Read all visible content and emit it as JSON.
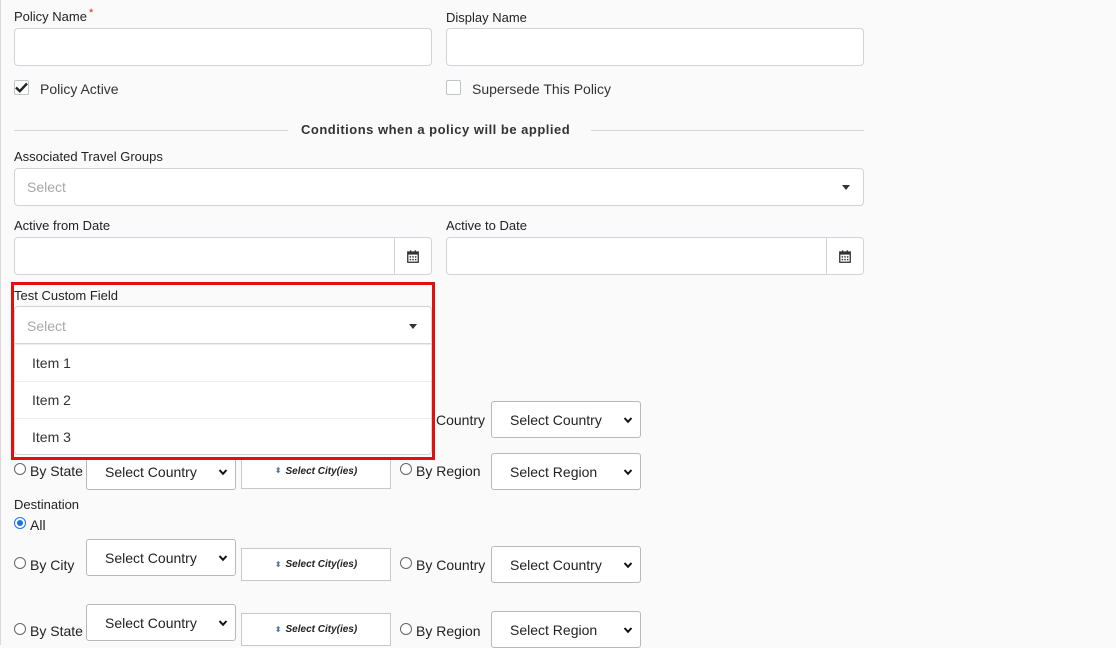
{
  "form": {
    "policy_name_label": "Policy Name",
    "policy_name_required": "*",
    "policy_name_value": "",
    "display_name_label": "Display Name",
    "display_name_value": "",
    "policy_active_label": "Policy Active",
    "policy_active_checked": true,
    "supersede_label": "Supersede This Policy",
    "supersede_checked": false,
    "conditions_heading": "Conditions when a policy will be applied",
    "travel_groups_label": "Associated Travel Groups",
    "travel_groups_placeholder": "Select",
    "active_from_label": "Active from Date",
    "active_from_value": "",
    "active_to_label": "Active to Date",
    "active_to_value": "",
    "custom_field_label": "Test Custom Field",
    "custom_field_placeholder": "Select",
    "custom_field_options": [
      "Item 1",
      "Item 2",
      "Item 3"
    ]
  },
  "origin": {
    "by_country_label": "Country",
    "country_select": "Select Country",
    "by_state_label": "By State",
    "state_country_select": "Select Country",
    "state_cities": "Select City(ies)",
    "by_region_label": "By Region",
    "region_select": "Select Region"
  },
  "destination": {
    "heading": "Destination",
    "all_label": "All",
    "all_selected": true,
    "by_city_label": "By City",
    "city_country_select": "Select Country",
    "city_cities": "Select City(ies)",
    "by_country_label": "By Country",
    "country_select": "Select Country",
    "by_state_label": "By State",
    "state_country_select": "Select Country",
    "state_cities": "Select City(ies)",
    "by_region_label": "By Region",
    "region_select": "Select Region"
  },
  "colors": {
    "highlight": "#e01010",
    "radio_selected": "#1a73e8",
    "required": "#d9261c"
  }
}
